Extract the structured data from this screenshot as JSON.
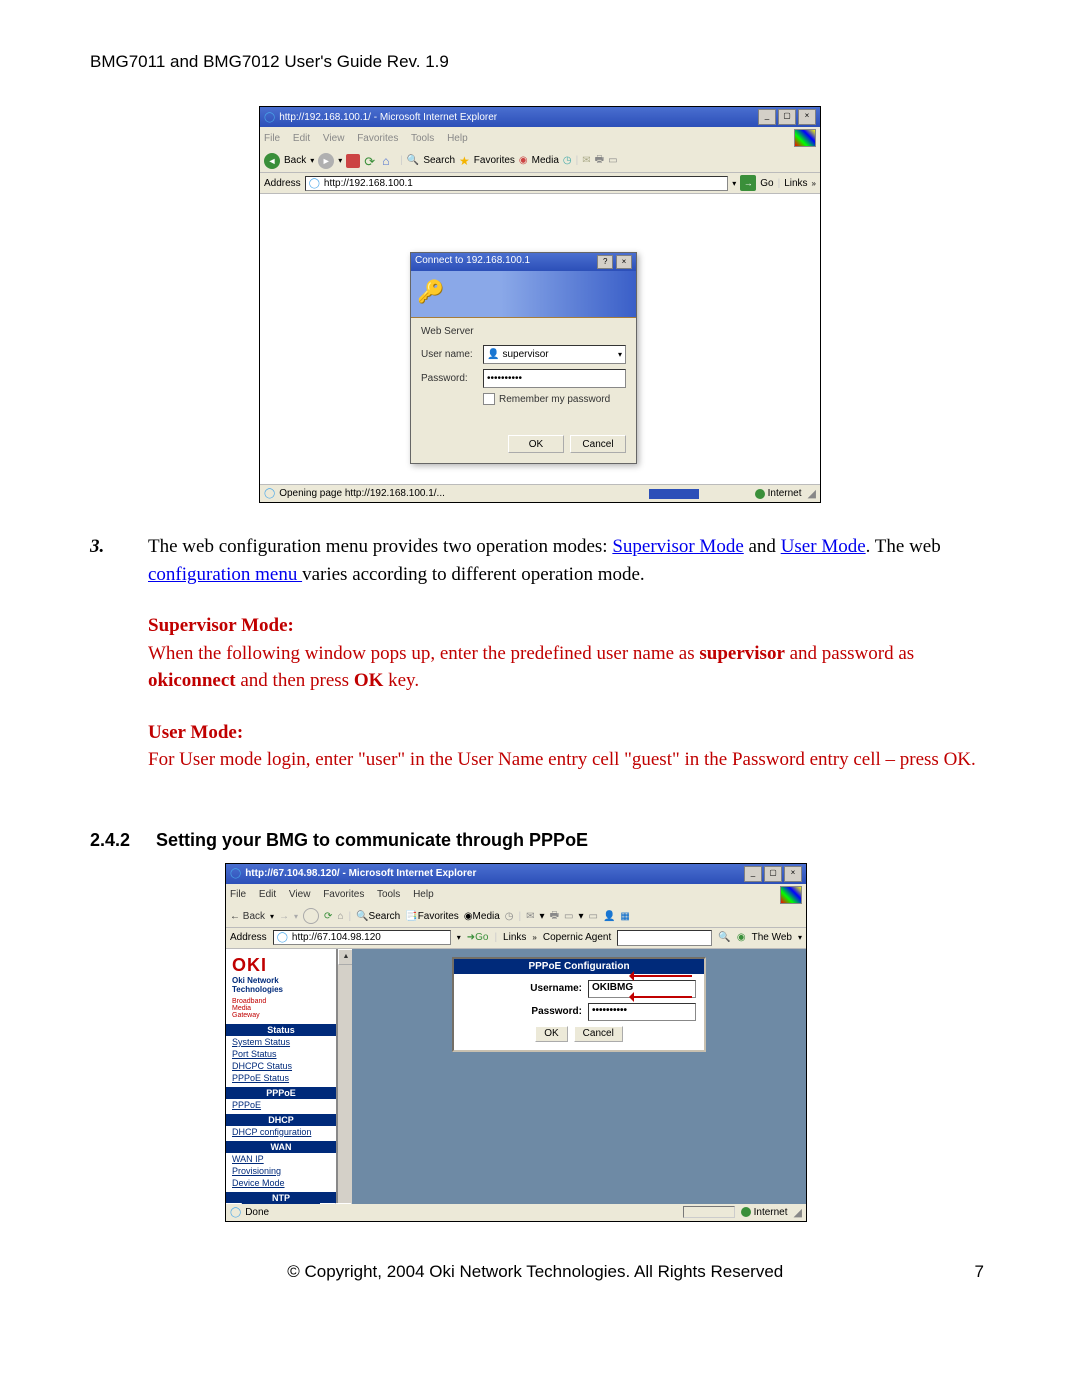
{
  "header": {
    "title": "BMG7011 and BMG7012 User's Guide Rev. 1.9"
  },
  "screenshot1": {
    "window_title": "http://192.168.100.1/ - Microsoft Internet Explorer",
    "menus": [
      "File",
      "Edit",
      "View",
      "Favorites",
      "Tools",
      "Help"
    ],
    "toolbar": {
      "back": "Back",
      "search": "Search",
      "favorites": "Favorites",
      "media": "Media"
    },
    "address_label": "Address",
    "address_value": "http://192.168.100.1",
    "go_label": "Go",
    "links_label": "Links",
    "dialog": {
      "title": "Connect to 192.168.100.1",
      "server_label": "Web Server",
      "user_label": "User name:",
      "user_value": "supervisor",
      "pass_label": "Password:",
      "pass_value": "••••••••••",
      "remember_label": "Remember my password",
      "ok": "OK",
      "cancel": "Cancel"
    },
    "status_text": "Opening page http://192.168.100.1/...",
    "zone": "Internet"
  },
  "body": {
    "num": "3.",
    "para_1a": "The web configuration menu provides two operation modes: ",
    "link_sup": "Supervisor Mode",
    "para_1b": " and ",
    "link_user": "User Mode",
    "para_1c": ". The web ",
    "link_cfg": "configuration menu ",
    "para_1d": "varies according to different operation mode.",
    "sup_head": "Supervisor Mode:",
    "sup_1": "When the following window pops up, enter the predefined user name as ",
    "sup_bold": "supervisor",
    "sup_2": " and password as ",
    "sup_oki": "okiconnect",
    "sup_3": " and then press ",
    "sup_ok": "OK",
    "sup_4": " key.",
    "user_head": "User Mode:",
    "user_1": " For User mode login, enter \"user\" in the User Name entry cell \"guest\" in the Password entry cell – press OK."
  },
  "section": {
    "num": "2.4.2",
    "title": "Setting your BMG to communicate through PPPoE"
  },
  "screenshot2": {
    "window_title": "http://67.104.98.120/ - Microsoft Internet Explorer",
    "menus": [
      "File",
      "Edit",
      "View",
      "Favorites",
      "Tools",
      "Help"
    ],
    "toolbar": {
      "back": "Back",
      "search": "Search",
      "favorites": "Favorites",
      "media": "Media"
    },
    "address_label": "Address",
    "address_value": "http://67.104.98.120",
    "go_label": "Go",
    "links_label": "Links",
    "copernic": "Copernic Agent",
    "theweb": "The Web",
    "sidebar": {
      "logo": "OKI",
      "subtitle": "Oki Network Technologies",
      "brand": "Broadband\nMedia\nGateway",
      "sections": [
        {
          "head": "Status",
          "links": [
            "System Status",
            "Port Status",
            "DHCPC Status",
            "PPPoE Status"
          ]
        },
        {
          "head": "PPPoE",
          "links": [
            "PPPoE"
          ]
        },
        {
          "head": "DHCP",
          "links": [
            "DHCP configuration"
          ]
        },
        {
          "head": "WAN",
          "links": [
            "WAN IP",
            "Provisioning",
            "Device Mode"
          ]
        },
        {
          "head": "NTP",
          "links": []
        }
      ]
    },
    "pppoe": {
      "title": "PPPoE Configuration",
      "user_label": "Username:",
      "user_value": "OKIBMG",
      "pass_label": "Password:",
      "pass_value": "••••••••••",
      "ok": "OK",
      "cancel": "Cancel"
    },
    "status_text": "Done",
    "zone": "Internet"
  },
  "footer": {
    "copyright": "© Copyright, 2004 Oki Network Technologies. All Rights Reserved",
    "page": "7"
  }
}
